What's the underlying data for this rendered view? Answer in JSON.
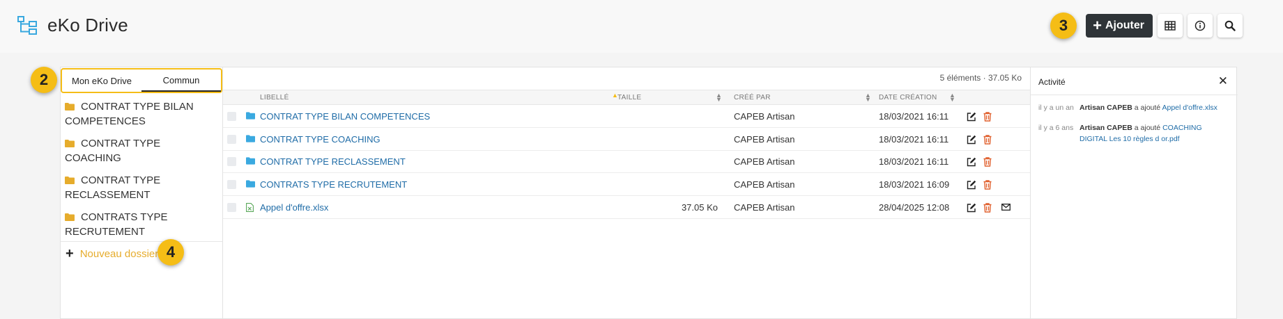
{
  "app": {
    "title": "eKo Drive"
  },
  "toolbar": {
    "add_label": "Ajouter",
    "icons": [
      "grid-icon",
      "info-icon",
      "search-icon"
    ]
  },
  "badges": {
    "b2": "2",
    "b3": "3",
    "b4": "4"
  },
  "sidebar": {
    "tabs": [
      {
        "label": "Mon eKo Drive",
        "active": false
      },
      {
        "label": "Commun",
        "active": true
      }
    ],
    "folders": [
      {
        "label": "CONTRAT TYPE BILAN COMPETENCES"
      },
      {
        "label": "CONTRAT TYPE COACHING"
      },
      {
        "label": "CONTRAT TYPE RECLASSEMENT"
      },
      {
        "label": "CONTRATS TYPE RECRUTEMENT"
      }
    ],
    "new_folder_label": "Nouveau dossier"
  },
  "files": {
    "summary": "5 éléments · 37.05 Ko",
    "columns": {
      "name": "LIBELLÉ",
      "size": "TAILLE",
      "created_by": "CRÉÉ PAR",
      "date": "DATE CRÉATION"
    },
    "rows": [
      {
        "type": "folder",
        "name": "CONTRAT TYPE BILAN COMPETENCES",
        "size": "",
        "created_by": "CAPEB Artisan",
        "date": "18/03/2021 16:11"
      },
      {
        "type": "folder",
        "name": "CONTRAT TYPE COACHING",
        "size": "",
        "created_by": "CAPEB Artisan",
        "date": "18/03/2021 16:11"
      },
      {
        "type": "folder",
        "name": "CONTRAT TYPE RECLASSEMENT",
        "size": "",
        "created_by": "CAPEB Artisan",
        "date": "18/03/2021 16:11"
      },
      {
        "type": "folder",
        "name": "CONTRATS TYPE RECRUTEMENT",
        "size": "",
        "created_by": "CAPEB Artisan",
        "date": "18/03/2021 16:09"
      },
      {
        "type": "file",
        "name": "Appel d'offre.xlsx",
        "size": "37.05 Ko",
        "created_by": "CAPEB Artisan",
        "date": "28/04/2025 12:08"
      }
    ]
  },
  "activity": {
    "title": "Activité",
    "entries": [
      {
        "time": "il y a un an",
        "user": "Artisan CAPEB",
        "action": "a ajouté",
        "target": "Appel d'offre.xlsx"
      },
      {
        "time": "il y a 6 ans",
        "user": "Artisan CAPEB",
        "action": "a ajouté",
        "target": "COACHING DIGITAL Les 10 règles d or.pdf"
      }
    ]
  },
  "colors": {
    "accent": "#f5bd16",
    "folder_blue": "#3aa9e0",
    "folder_orange": "#e6ac2c",
    "link": "#1f6ca7",
    "delete": "#e0612f",
    "dark_button": "#2f3438"
  }
}
